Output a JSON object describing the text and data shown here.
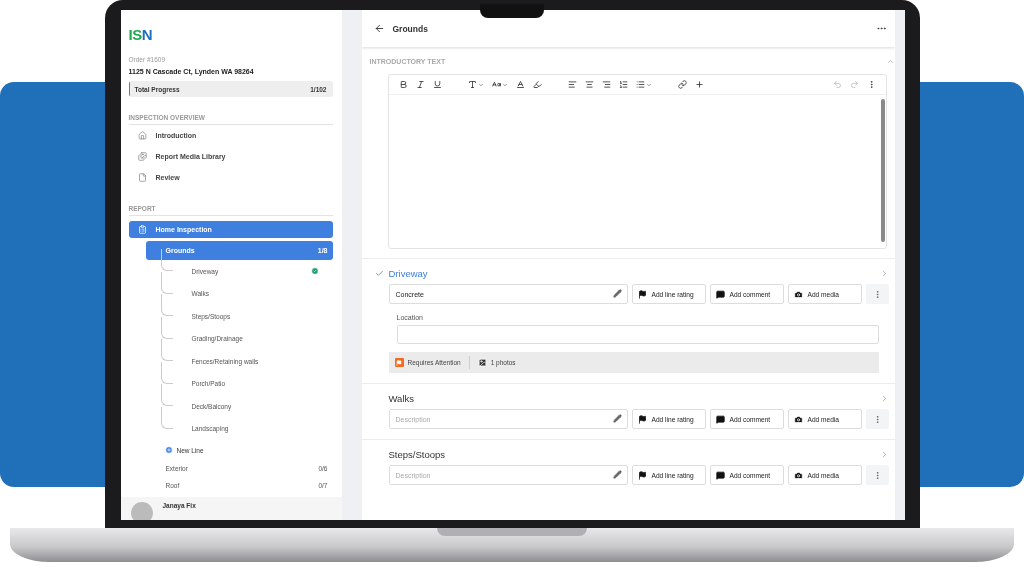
{
  "sidebar": {
    "logo": "ISN",
    "order": "Order #1609",
    "address": "1125 N Cascade Ct, Lynden WA 98264",
    "progress": {
      "label": "Total Progress",
      "value": "1/102",
      "level": 0.0098
    },
    "overview": {
      "heading": "INSPECTION OVERVIEW",
      "items": [
        {
          "label": "Introduction"
        },
        {
          "label": "Report Media Library"
        },
        {
          "label": "Review"
        }
      ]
    },
    "report": {
      "heading": "REPORT",
      "template": {
        "label": "Home Inspection",
        "selected": true
      },
      "sections": [
        {
          "label": "Grounds",
          "count": "1/8",
          "selected": true,
          "expanded": true,
          "new_line": "New Line",
          "children": [
            {
              "label": "Driveway",
              "done": true
            },
            {
              "label": "Walks",
              "done": false
            },
            {
              "label": "Steps/Stoops",
              "done": false
            },
            {
              "label": "Grading/Drainage",
              "done": false
            },
            {
              "label": "Fences/Retaining walls",
              "done": false
            },
            {
              "label": "Porch/Patio",
              "done": false
            },
            {
              "label": "Deck/Balcony",
              "done": false
            },
            {
              "label": "Landscaping",
              "done": false
            }
          ]
        },
        {
          "label": "Exterior",
          "count": "0/6",
          "selected": false
        },
        {
          "label": "Roof",
          "count": "0/7",
          "selected": false
        }
      ]
    },
    "user": {
      "name": "Janaya Fix"
    }
  },
  "main": {
    "header": {
      "title": "Grounds"
    },
    "intro": {
      "label": "INTRODUCTORY TEXT",
      "expanded": true
    },
    "items": [
      {
        "title": "Driveway",
        "done": true,
        "value": "Concrete",
        "location_label": "Location",
        "rating": "Requires Attention",
        "photos": "1 photos",
        "actions": [
          "Add line rating",
          "Add comment",
          "Add media"
        ]
      },
      {
        "title": "Walks",
        "done": false,
        "placeholder": "Description",
        "actions": [
          "Add line rating",
          "Add comment",
          "Add media"
        ]
      },
      {
        "title": "Steps/Stoops",
        "done": false,
        "placeholder": "Description",
        "actions": [
          "Add line rating",
          "Add comment",
          "Add media"
        ]
      }
    ]
  }
}
